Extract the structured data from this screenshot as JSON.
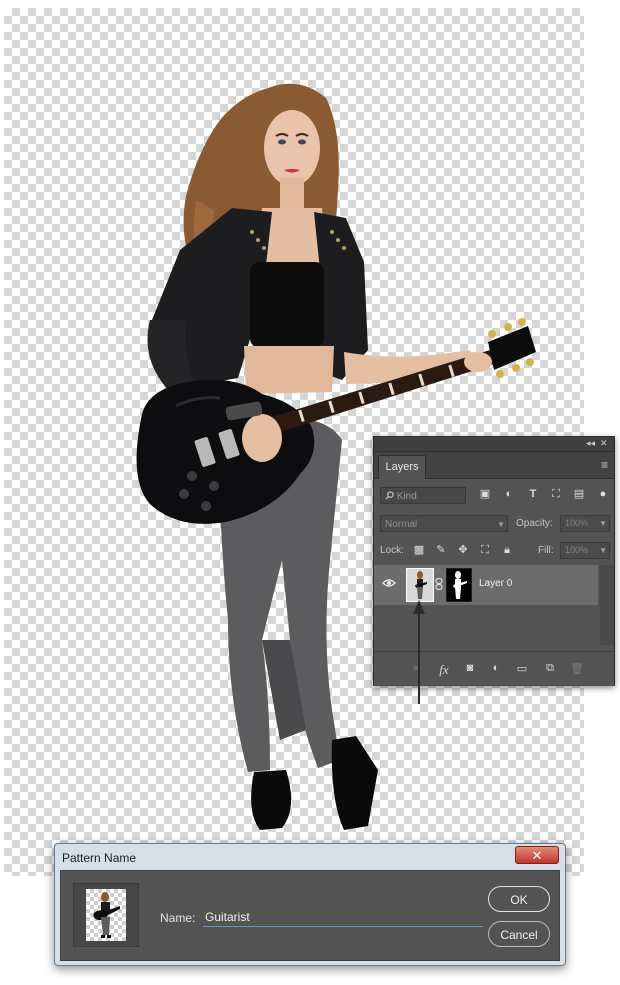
{
  "layers_panel": {
    "collapse_glyph": "◂◂",
    "close_glyph": "✕",
    "tab_label": "Layers",
    "menu_glyph": "≡",
    "kind_placeholder": "Kind",
    "blend_mode": "Normal",
    "opacity_label": "Opacity:",
    "opacity_value": "100%",
    "lock_label": "Lock:",
    "fill_label": "Fill:",
    "fill_value": "100%",
    "layer": {
      "name": "Layer 0",
      "visible": true,
      "has_mask": true
    },
    "bottom_icons": [
      "link-icon",
      "fx-icon",
      "add-mask-icon",
      "adjustment-icon",
      "group-folder-icon",
      "new-layer-icon",
      "trash-icon"
    ],
    "fx_label": "fx"
  },
  "dialog": {
    "title": "Pattern Name",
    "close_glyph": "✕",
    "name_label": "Name:",
    "name_value": "Guitarist",
    "ok_label": "OK",
    "cancel_label": "Cancel"
  },
  "colors": {
    "panel_bg": "#535353",
    "panel_dark": "#424242",
    "layer_selected": "#6c6c6c",
    "dialog_frame": "#d6dee8",
    "close_red": "#c0392b",
    "input_underline": "#6b8fd6"
  }
}
